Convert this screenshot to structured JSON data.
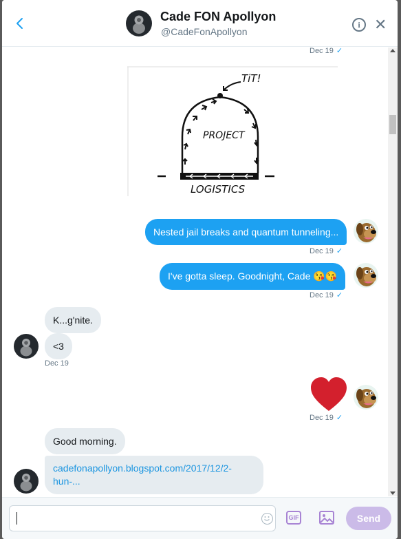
{
  "header": {
    "name": "Cade FON Apollyon",
    "handle": "@CadeFonApollyon",
    "info_symbol": "i",
    "close_symbol": "✕",
    "back_icon": "chevron-left-icon"
  },
  "messages": {
    "stamp_top": "Dec 19",
    "sketch": {
      "label_top": "TiT!",
      "label_center": "PROJECT",
      "label_bottom": "LOGISTICS"
    },
    "out_1": {
      "text": "Nested jail breaks and quantum tunneling...",
      "stamp": "Dec 19"
    },
    "out_2": {
      "text": "I've gotta sleep. Goodnight, Cade 😘😘",
      "stamp": "Dec 19"
    },
    "in_1": {
      "text": "K...g'nite."
    },
    "in_2": {
      "text": "<3",
      "stamp": "Dec 19"
    },
    "heart": {
      "emoji": "heart-icon",
      "stamp": "Dec 19"
    },
    "in_3": {
      "text": "Good morning."
    },
    "in_4": {
      "text": "cadefonapollyon.blogspot.com/2017/12/2-hun-..."
    },
    "check_symbol": "✓"
  },
  "composer": {
    "gif_label": "GIF",
    "send_label": "Send"
  },
  "colors": {
    "accent": "#1da1f2",
    "incoming_bubble": "#e6ecf0",
    "send_button": "#cbbbe8",
    "heart": "#d3202d"
  }
}
